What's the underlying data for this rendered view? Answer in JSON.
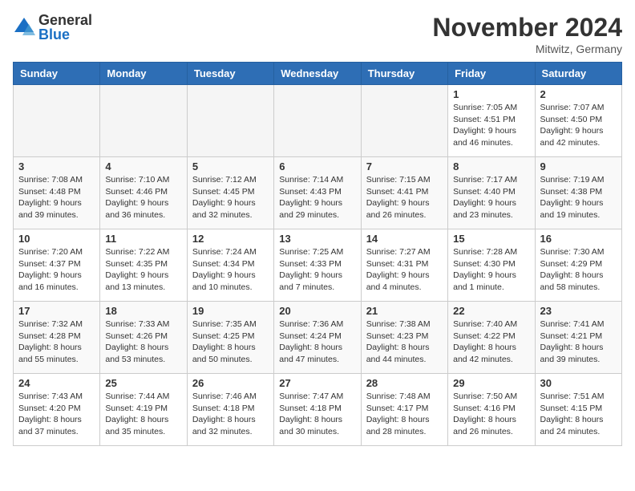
{
  "logo": {
    "general": "General",
    "blue": "Blue"
  },
  "title": "November 2024",
  "location": "Mitwitz, Germany",
  "days_of_week": [
    "Sunday",
    "Monday",
    "Tuesday",
    "Wednesday",
    "Thursday",
    "Friday",
    "Saturday"
  ],
  "weeks": [
    [
      {
        "day": "",
        "info": ""
      },
      {
        "day": "",
        "info": ""
      },
      {
        "day": "",
        "info": ""
      },
      {
        "day": "",
        "info": ""
      },
      {
        "day": "",
        "info": ""
      },
      {
        "day": "1",
        "info": "Sunrise: 7:05 AM\nSunset: 4:51 PM\nDaylight: 9 hours and 46 minutes."
      },
      {
        "day": "2",
        "info": "Sunrise: 7:07 AM\nSunset: 4:50 PM\nDaylight: 9 hours and 42 minutes."
      }
    ],
    [
      {
        "day": "3",
        "info": "Sunrise: 7:08 AM\nSunset: 4:48 PM\nDaylight: 9 hours and 39 minutes."
      },
      {
        "day": "4",
        "info": "Sunrise: 7:10 AM\nSunset: 4:46 PM\nDaylight: 9 hours and 36 minutes."
      },
      {
        "day": "5",
        "info": "Sunrise: 7:12 AM\nSunset: 4:45 PM\nDaylight: 9 hours and 32 minutes."
      },
      {
        "day": "6",
        "info": "Sunrise: 7:14 AM\nSunset: 4:43 PM\nDaylight: 9 hours and 29 minutes."
      },
      {
        "day": "7",
        "info": "Sunrise: 7:15 AM\nSunset: 4:41 PM\nDaylight: 9 hours and 26 minutes."
      },
      {
        "day": "8",
        "info": "Sunrise: 7:17 AM\nSunset: 4:40 PM\nDaylight: 9 hours and 23 minutes."
      },
      {
        "day": "9",
        "info": "Sunrise: 7:19 AM\nSunset: 4:38 PM\nDaylight: 9 hours and 19 minutes."
      }
    ],
    [
      {
        "day": "10",
        "info": "Sunrise: 7:20 AM\nSunset: 4:37 PM\nDaylight: 9 hours and 16 minutes."
      },
      {
        "day": "11",
        "info": "Sunrise: 7:22 AM\nSunset: 4:35 PM\nDaylight: 9 hours and 13 minutes."
      },
      {
        "day": "12",
        "info": "Sunrise: 7:24 AM\nSunset: 4:34 PM\nDaylight: 9 hours and 10 minutes."
      },
      {
        "day": "13",
        "info": "Sunrise: 7:25 AM\nSunset: 4:33 PM\nDaylight: 9 hours and 7 minutes."
      },
      {
        "day": "14",
        "info": "Sunrise: 7:27 AM\nSunset: 4:31 PM\nDaylight: 9 hours and 4 minutes."
      },
      {
        "day": "15",
        "info": "Sunrise: 7:28 AM\nSunset: 4:30 PM\nDaylight: 9 hours and 1 minute."
      },
      {
        "day": "16",
        "info": "Sunrise: 7:30 AM\nSunset: 4:29 PM\nDaylight: 8 hours and 58 minutes."
      }
    ],
    [
      {
        "day": "17",
        "info": "Sunrise: 7:32 AM\nSunset: 4:28 PM\nDaylight: 8 hours and 55 minutes."
      },
      {
        "day": "18",
        "info": "Sunrise: 7:33 AM\nSunset: 4:26 PM\nDaylight: 8 hours and 53 minutes."
      },
      {
        "day": "19",
        "info": "Sunrise: 7:35 AM\nSunset: 4:25 PM\nDaylight: 8 hours and 50 minutes."
      },
      {
        "day": "20",
        "info": "Sunrise: 7:36 AM\nSunset: 4:24 PM\nDaylight: 8 hours and 47 minutes."
      },
      {
        "day": "21",
        "info": "Sunrise: 7:38 AM\nSunset: 4:23 PM\nDaylight: 8 hours and 44 minutes."
      },
      {
        "day": "22",
        "info": "Sunrise: 7:40 AM\nSunset: 4:22 PM\nDaylight: 8 hours and 42 minutes."
      },
      {
        "day": "23",
        "info": "Sunrise: 7:41 AM\nSunset: 4:21 PM\nDaylight: 8 hours and 39 minutes."
      }
    ],
    [
      {
        "day": "24",
        "info": "Sunrise: 7:43 AM\nSunset: 4:20 PM\nDaylight: 8 hours and 37 minutes."
      },
      {
        "day": "25",
        "info": "Sunrise: 7:44 AM\nSunset: 4:19 PM\nDaylight: 8 hours and 35 minutes."
      },
      {
        "day": "26",
        "info": "Sunrise: 7:46 AM\nSunset: 4:18 PM\nDaylight: 8 hours and 32 minutes."
      },
      {
        "day": "27",
        "info": "Sunrise: 7:47 AM\nSunset: 4:18 PM\nDaylight: 8 hours and 30 minutes."
      },
      {
        "day": "28",
        "info": "Sunrise: 7:48 AM\nSunset: 4:17 PM\nDaylight: 8 hours and 28 minutes."
      },
      {
        "day": "29",
        "info": "Sunrise: 7:50 AM\nSunset: 4:16 PM\nDaylight: 8 hours and 26 minutes."
      },
      {
        "day": "30",
        "info": "Sunrise: 7:51 AM\nSunset: 4:15 PM\nDaylight: 8 hours and 24 minutes."
      }
    ]
  ]
}
